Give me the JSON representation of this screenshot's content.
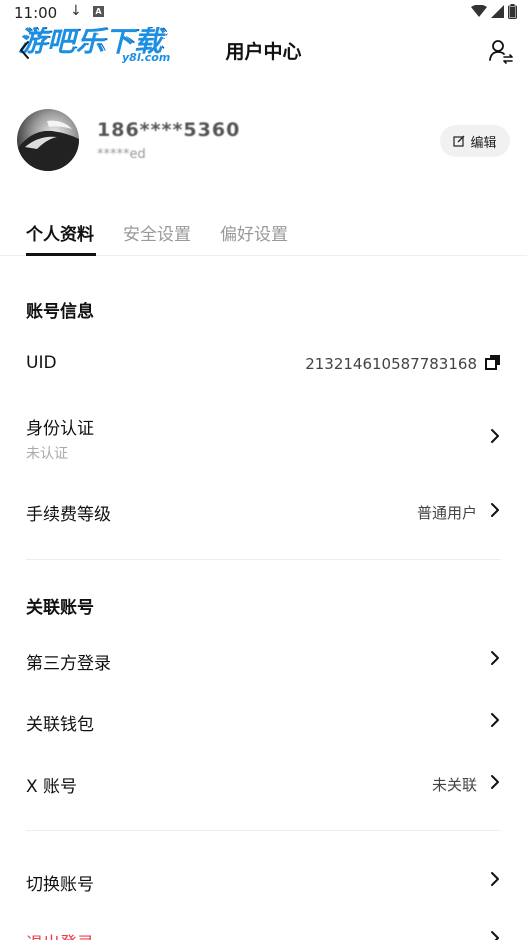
{
  "status_bar": {
    "time": "11:00",
    "download_glyph": "↓",
    "notification_letter": "A"
  },
  "watermark": {
    "main": "游吧乐下载",
    "sub": "y8l.com"
  },
  "header": {
    "title": "用户中心"
  },
  "profile": {
    "name": "186****5360",
    "sub": "*****ed",
    "edit_label": "编辑"
  },
  "tabs": [
    {
      "label": "个人资料",
      "active": true
    },
    {
      "label": "安全设置",
      "active": false
    },
    {
      "label": "偏好设置",
      "active": false
    }
  ],
  "account_info": {
    "title": "账号信息",
    "uid_label": "UID",
    "uid_value": "213214610587783168",
    "identity_label": "身份认证",
    "identity_status": "未认证",
    "fee_label": "手续费等级",
    "fee_value": "普通用户"
  },
  "linked_accounts": {
    "title": "关联账号",
    "third_party_label": "第三方登录",
    "wallet_label": "关联钱包",
    "x_label": "X 账号",
    "x_value": "未关联"
  },
  "actions": {
    "switch_label": "切换账号",
    "logout_label": "退出登录"
  },
  "colors": {
    "accent_text": "#111111",
    "muted_text": "#999999",
    "logout": "#e8404d",
    "watermark_blue": "#1a8fe3"
  },
  "icons": {
    "back": "chevron-left-icon",
    "user_switch": "user-switch-icon",
    "edit": "edit-icon",
    "copy": "copy-icon",
    "chevron": "chevron-right-icon"
  }
}
